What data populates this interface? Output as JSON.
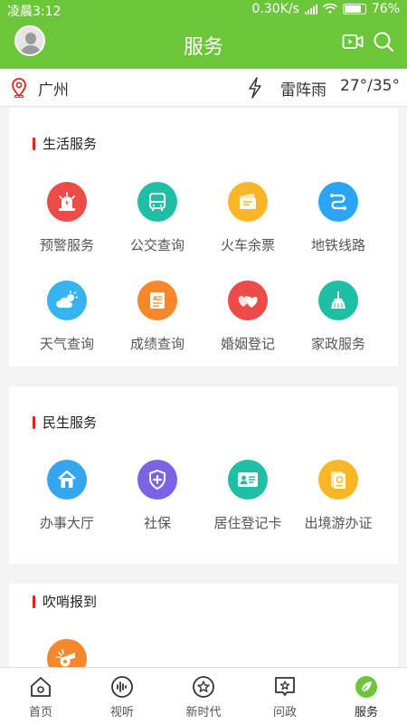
{
  "status": {
    "time": "凌晨3:12",
    "speed": "0.30K/s",
    "battery": "76%"
  },
  "header": {
    "title": "服务"
  },
  "location": {
    "city": "广州",
    "weather": "雷阵雨",
    "temp": "27°/35°"
  },
  "sections": [
    {
      "title": "生活服务",
      "items": [
        {
          "label": "预警服务",
          "icon": "alarm-icon",
          "color": "#ec4b47"
        },
        {
          "label": "公交查询",
          "icon": "bus-icon",
          "color": "#1fbfa6"
        },
        {
          "label": "火车余票",
          "icon": "ticket-icon",
          "color": "#fbb627"
        },
        {
          "label": "地铁线路",
          "icon": "subway-route-icon",
          "color": "#2aa4f4"
        },
        {
          "label": "天气查询",
          "icon": "weather-icon",
          "color": "#37b4f0"
        },
        {
          "label": "成绩查询",
          "icon": "grade-icon",
          "color": "#f6872b"
        },
        {
          "label": "婚姻登记",
          "icon": "marriage-icon",
          "color": "#ec4b47"
        },
        {
          "label": "家政服务",
          "icon": "housekeeping-icon",
          "color": "#1fbfa6"
        }
      ]
    },
    {
      "title": "民生服务",
      "items": [
        {
          "label": "办事大厅",
          "icon": "house-icon",
          "color": "#37a6f0"
        },
        {
          "label": "社保",
          "icon": "shield-icon",
          "color": "#7b63e6"
        },
        {
          "label": "居住登记卡",
          "icon": "id-card-icon",
          "color": "#1fbfa6"
        },
        {
          "label": "出境游办证",
          "icon": "passport-icon",
          "color": "#fbb627"
        }
      ]
    },
    {
      "title": "吹哨报到",
      "items": [
        {
          "label": "",
          "icon": "whistle-icon",
          "color": "#f6872b"
        }
      ]
    }
  ],
  "tabs": [
    {
      "label": "首页",
      "icon": "home-icon"
    },
    {
      "label": "视听",
      "icon": "audio-icon"
    },
    {
      "label": "新时代",
      "icon": "star-icon"
    },
    {
      "label": "问政",
      "icon": "question-icon"
    },
    {
      "label": "服务",
      "icon": "leaf-icon",
      "active": true,
      "color": "#6cc63a"
    }
  ]
}
